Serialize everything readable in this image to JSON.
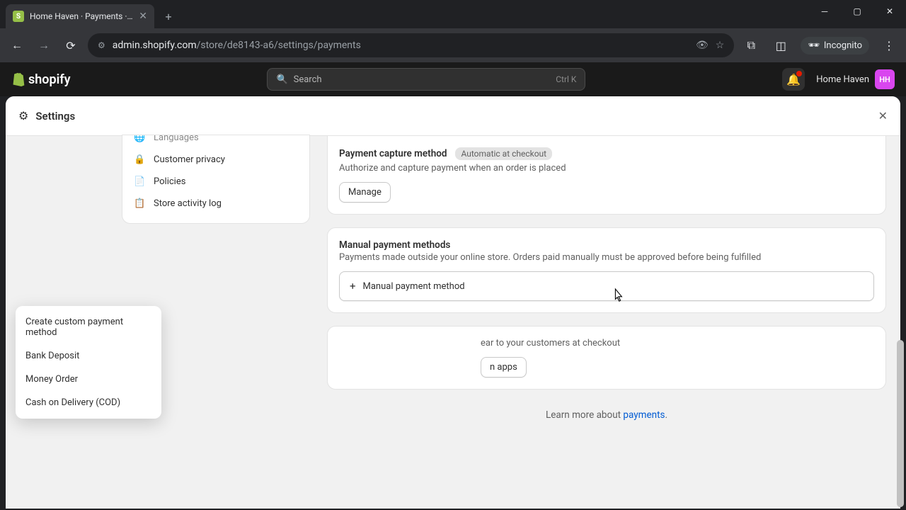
{
  "browser": {
    "tab_title": "Home Haven · Payments · Shop",
    "url_host": "admin.shopify.com",
    "url_path": "/store/de8143-a6/settings/payments",
    "incognito_label": "Incognito"
  },
  "topbar": {
    "brand": "shopify",
    "search_placeholder": "Search",
    "search_shortcut": "Ctrl K",
    "store_name": "Home Haven",
    "store_initials": "HH"
  },
  "settings": {
    "title": "Settings"
  },
  "sidebar": {
    "items": [
      {
        "label": "Languages",
        "icon": "🌐"
      },
      {
        "label": "Customer privacy",
        "icon": "🔒"
      },
      {
        "label": "Policies",
        "icon": "📄"
      },
      {
        "label": "Store activity log",
        "icon": "📋"
      }
    ]
  },
  "capture": {
    "title": "Payment capture method",
    "badge": "Automatic at checkout",
    "desc": "Authorize and capture payment when an order is placed",
    "manage": "Manage"
  },
  "manual": {
    "title": "Manual payment methods",
    "desc": "Payments made outside your online store. Orders paid manually must be approved before being fulfilled",
    "button": "Manual payment method",
    "options": [
      "Create custom payment method",
      "Bank Deposit",
      "Money Order",
      "Cash on Delivery (COD)"
    ]
  },
  "customize": {
    "desc_partial": "ear to your customers at checkout",
    "button_partial": "n apps"
  },
  "learn": {
    "prefix": "Learn more about ",
    "link": "payments",
    "suffix": "."
  }
}
